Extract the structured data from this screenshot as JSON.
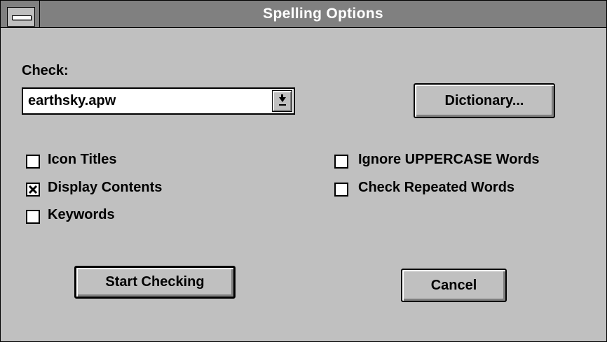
{
  "window": {
    "title": "Spelling Options"
  },
  "check": {
    "label": "Check:",
    "selected": "earthsky.apw"
  },
  "buttons": {
    "dictionary": "Dictionary...",
    "start": "Start Checking",
    "cancel": "Cancel"
  },
  "checkboxes": {
    "icon_titles": {
      "label": "Icon Titles",
      "checked": false
    },
    "display_contents": {
      "label": "Display Contents",
      "checked": true
    },
    "keywords": {
      "label": "Keywords",
      "checked": false
    },
    "ignore_uppercase": {
      "label": "Ignore UPPERCASE Words",
      "checked": false
    },
    "check_repeated": {
      "label": "Check Repeated Words",
      "checked": false
    }
  },
  "icons": {
    "system_menu": "system-menu-icon",
    "dropdown": "dropdown-arrow-icon",
    "check_mark": "x-mark-icon"
  },
  "colors": {
    "dialog_bg": "#c0c0c0",
    "titlebar_bg": "#808080",
    "title_text": "#ffffff"
  }
}
